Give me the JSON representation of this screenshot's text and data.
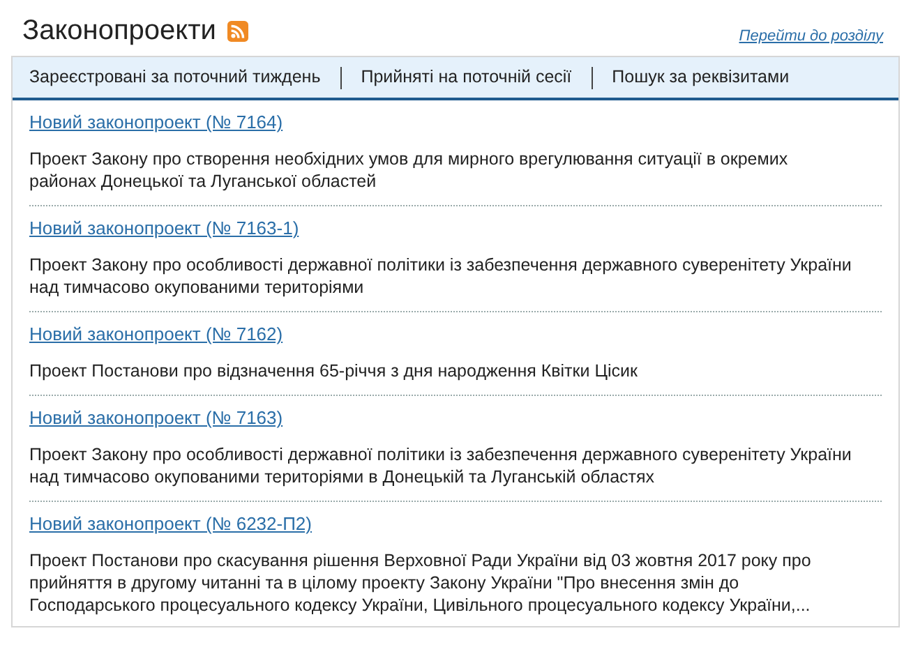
{
  "header": {
    "title": "Законопроекти",
    "section_link": "Перейти до розділу"
  },
  "tabs": [
    {
      "label": "Зареєстровані за поточний тиждень",
      "selected": false
    },
    {
      "label": "Прийняті на поточній сесії",
      "selected": false
    },
    {
      "label": "Пошук за реквізитами",
      "selected": false
    }
  ],
  "bills": [
    {
      "link": "Новий законопроект (№ 7164)",
      "description": "Проект Закону про створення необхідних умов для мирного врегулювання ситуації в окремих районах Донецької та Луганської областей"
    },
    {
      "link": "Новий законопроект (№ 7163-1)",
      "description": "Проект Закону про особливості державної політики із забезпечення державного суверенітету України над тимчасово окупованими територіями"
    },
    {
      "link": "Новий законопроект (№ 7162)",
      "description": "Проект Постанови про відзначення 65-річчя з дня народження Квітки Цісик"
    },
    {
      "link": "Новий законопроект (№ 7163)",
      "description": "Проект Закону про особливості державної політики із забезпечення державного суверенітету України над тимчасово окупованими територіями в Донецькій та Луганській областях"
    },
    {
      "link": "Новий законопроект (№ 6232-П2)",
      "description": "Проект Постанови про скасування рішення Верховної Ради України від 03 жовтня 2017 року про прийняття в другому читанні та в цілому проекту Закону України \"Про внесення змін до Господарського процесуального кодексу України, Цивільного процесуального кодексу України,..."
    }
  ]
}
